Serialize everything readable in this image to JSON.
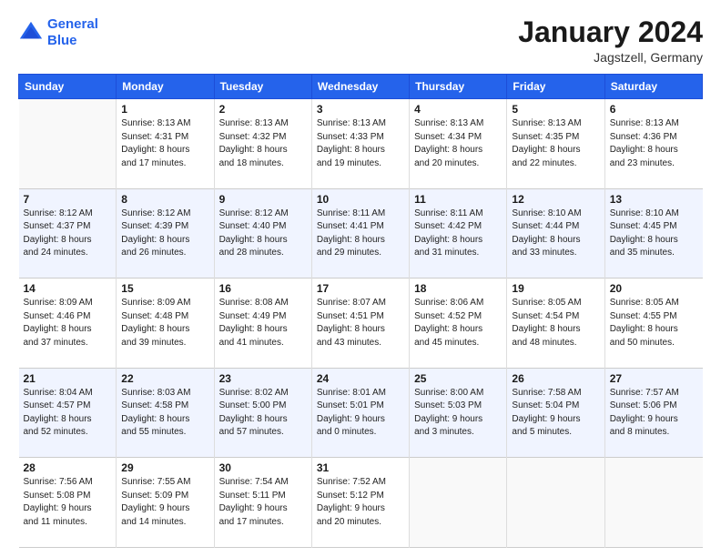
{
  "logo": {
    "line1": "General",
    "line2": "Blue"
  },
  "title": "January 2024",
  "subtitle": "Jagstzell, Germany",
  "header": {
    "days": [
      "Sunday",
      "Monday",
      "Tuesday",
      "Wednesday",
      "Thursday",
      "Friday",
      "Saturday"
    ]
  },
  "weeks": [
    [
      {
        "num": "",
        "text": ""
      },
      {
        "num": "1",
        "text": "Sunrise: 8:13 AM\nSunset: 4:31 PM\nDaylight: 8 hours\nand 17 minutes."
      },
      {
        "num": "2",
        "text": "Sunrise: 8:13 AM\nSunset: 4:32 PM\nDaylight: 8 hours\nand 18 minutes."
      },
      {
        "num": "3",
        "text": "Sunrise: 8:13 AM\nSunset: 4:33 PM\nDaylight: 8 hours\nand 19 minutes."
      },
      {
        "num": "4",
        "text": "Sunrise: 8:13 AM\nSunset: 4:34 PM\nDaylight: 8 hours\nand 20 minutes."
      },
      {
        "num": "5",
        "text": "Sunrise: 8:13 AM\nSunset: 4:35 PM\nDaylight: 8 hours\nand 22 minutes."
      },
      {
        "num": "6",
        "text": "Sunrise: 8:13 AM\nSunset: 4:36 PM\nDaylight: 8 hours\nand 23 minutes."
      }
    ],
    [
      {
        "num": "7",
        "text": "Sunrise: 8:12 AM\nSunset: 4:37 PM\nDaylight: 8 hours\nand 24 minutes."
      },
      {
        "num": "8",
        "text": "Sunrise: 8:12 AM\nSunset: 4:39 PM\nDaylight: 8 hours\nand 26 minutes."
      },
      {
        "num": "9",
        "text": "Sunrise: 8:12 AM\nSunset: 4:40 PM\nDaylight: 8 hours\nand 28 minutes."
      },
      {
        "num": "10",
        "text": "Sunrise: 8:11 AM\nSunset: 4:41 PM\nDaylight: 8 hours\nand 29 minutes."
      },
      {
        "num": "11",
        "text": "Sunrise: 8:11 AM\nSunset: 4:42 PM\nDaylight: 8 hours\nand 31 minutes."
      },
      {
        "num": "12",
        "text": "Sunrise: 8:10 AM\nSunset: 4:44 PM\nDaylight: 8 hours\nand 33 minutes."
      },
      {
        "num": "13",
        "text": "Sunrise: 8:10 AM\nSunset: 4:45 PM\nDaylight: 8 hours\nand 35 minutes."
      }
    ],
    [
      {
        "num": "14",
        "text": "Sunrise: 8:09 AM\nSunset: 4:46 PM\nDaylight: 8 hours\nand 37 minutes."
      },
      {
        "num": "15",
        "text": "Sunrise: 8:09 AM\nSunset: 4:48 PM\nDaylight: 8 hours\nand 39 minutes."
      },
      {
        "num": "16",
        "text": "Sunrise: 8:08 AM\nSunset: 4:49 PM\nDaylight: 8 hours\nand 41 minutes."
      },
      {
        "num": "17",
        "text": "Sunrise: 8:07 AM\nSunset: 4:51 PM\nDaylight: 8 hours\nand 43 minutes."
      },
      {
        "num": "18",
        "text": "Sunrise: 8:06 AM\nSunset: 4:52 PM\nDaylight: 8 hours\nand 45 minutes."
      },
      {
        "num": "19",
        "text": "Sunrise: 8:05 AM\nSunset: 4:54 PM\nDaylight: 8 hours\nand 48 minutes."
      },
      {
        "num": "20",
        "text": "Sunrise: 8:05 AM\nSunset: 4:55 PM\nDaylight: 8 hours\nand 50 minutes."
      }
    ],
    [
      {
        "num": "21",
        "text": "Sunrise: 8:04 AM\nSunset: 4:57 PM\nDaylight: 8 hours\nand 52 minutes."
      },
      {
        "num": "22",
        "text": "Sunrise: 8:03 AM\nSunset: 4:58 PM\nDaylight: 8 hours\nand 55 minutes."
      },
      {
        "num": "23",
        "text": "Sunrise: 8:02 AM\nSunset: 5:00 PM\nDaylight: 8 hours\nand 57 minutes."
      },
      {
        "num": "24",
        "text": "Sunrise: 8:01 AM\nSunset: 5:01 PM\nDaylight: 9 hours\nand 0 minutes."
      },
      {
        "num": "25",
        "text": "Sunrise: 8:00 AM\nSunset: 5:03 PM\nDaylight: 9 hours\nand 3 minutes."
      },
      {
        "num": "26",
        "text": "Sunrise: 7:58 AM\nSunset: 5:04 PM\nDaylight: 9 hours\nand 5 minutes."
      },
      {
        "num": "27",
        "text": "Sunrise: 7:57 AM\nSunset: 5:06 PM\nDaylight: 9 hours\nand 8 minutes."
      }
    ],
    [
      {
        "num": "28",
        "text": "Sunrise: 7:56 AM\nSunset: 5:08 PM\nDaylight: 9 hours\nand 11 minutes."
      },
      {
        "num": "29",
        "text": "Sunrise: 7:55 AM\nSunset: 5:09 PM\nDaylight: 9 hours\nand 14 minutes."
      },
      {
        "num": "30",
        "text": "Sunrise: 7:54 AM\nSunset: 5:11 PM\nDaylight: 9 hours\nand 17 minutes."
      },
      {
        "num": "31",
        "text": "Sunrise: 7:52 AM\nSunset: 5:12 PM\nDaylight: 9 hours\nand 20 minutes."
      },
      {
        "num": "",
        "text": ""
      },
      {
        "num": "",
        "text": ""
      },
      {
        "num": "",
        "text": ""
      }
    ]
  ]
}
